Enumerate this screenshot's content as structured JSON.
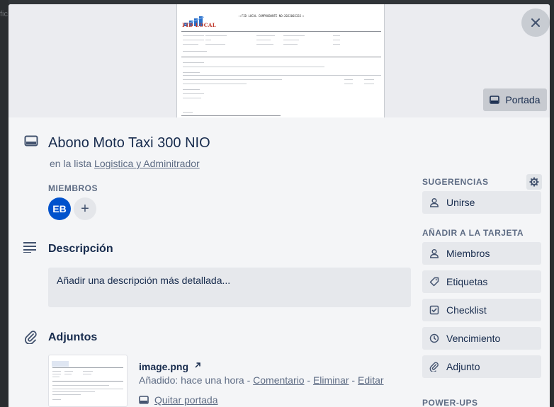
{
  "background": {
    "ghost_text": "fic"
  },
  "cover": {
    "image": {
      "brand": "FID LOCAL",
      "header": "::FID LOCAL COMPROBANTE NO:2022002332::"
    },
    "cover_button_label": "Portada"
  },
  "card": {
    "title": "Abono Moto Taxi 300 NIO",
    "list_prefix": "en la lista",
    "list_name": "Logistica y Adminitrador"
  },
  "members": {
    "label": "MIEMBROS",
    "avatars": [
      {
        "initials": "EB",
        "color": "#0052cc"
      }
    ],
    "add_label": "+"
  },
  "description": {
    "heading": "Descripción",
    "placeholder": "Añadir una descripción más detallada..."
  },
  "attachments": {
    "heading": "Adjuntos",
    "items": [
      {
        "filename": "image.png",
        "added_prefix": "Añadido: hace una hora",
        "sep": " - ",
        "actions": {
          "comment": "Comentario",
          "delete": "Eliminar",
          "edit": "Editar"
        },
        "remove_cover": "Quitar portada"
      }
    ]
  },
  "sidebar": {
    "suggestions_label": "SUGERENCIAS",
    "join_label": "Unirse",
    "add_to_card_label": "AÑADIR A LA TARJETA",
    "buttons": [
      {
        "label": "Miembros",
        "icon": "person-icon"
      },
      {
        "label": "Etiquetas",
        "icon": "tag-icon"
      },
      {
        "label": "Checklist",
        "icon": "checklist-icon"
      },
      {
        "label": "Vencimiento",
        "icon": "clock-icon"
      },
      {
        "label": "Adjunto",
        "icon": "paperclip-icon"
      }
    ],
    "powerups_label": "POWER-UPS"
  },
  "colors": {
    "accent": "#0052cc",
    "modal_bg": "#f4f5f7",
    "button_bg": "#e6e8ec"
  }
}
